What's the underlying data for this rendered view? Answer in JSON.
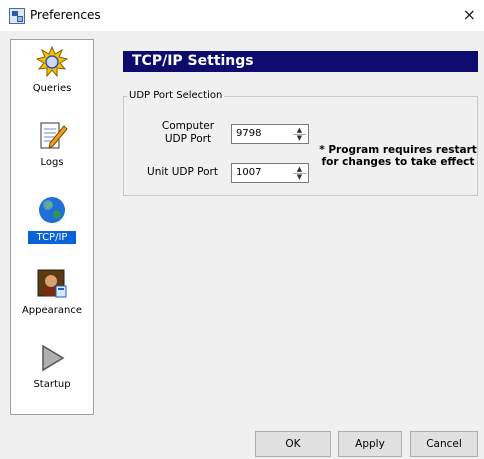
{
  "window": {
    "title": "Preferences",
    "close_glyph": "×"
  },
  "sidebar": {
    "items": [
      {
        "label": "Queries",
        "icon": "queries-sun-icon",
        "active": false
      },
      {
        "label": "Logs",
        "icon": "logs-notepad-icon",
        "active": false
      },
      {
        "label": "TCP/IP",
        "icon": "globe-icon",
        "active": true
      },
      {
        "label": "Appearance",
        "icon": "appearance-portrait-icon",
        "active": false
      },
      {
        "label": "Startup",
        "icon": "startup-play-icon",
        "active": false
      }
    ]
  },
  "panel": {
    "header": "TCP/IP Settings",
    "group": {
      "title": "UDP Port Selection",
      "computer_port": {
        "label": "Computer UDP Port",
        "value": "9798"
      },
      "unit_port": {
        "label": "Unit UDP Port",
        "value": "1007"
      }
    },
    "notice": "* Program requires restart for changes to take effect"
  },
  "buttons": {
    "ok": "OK",
    "apply": "Apply",
    "cancel": "Cancel"
  },
  "colors": {
    "header_bg": "#0c0c6e",
    "selected_bg": "#0a62d8"
  }
}
